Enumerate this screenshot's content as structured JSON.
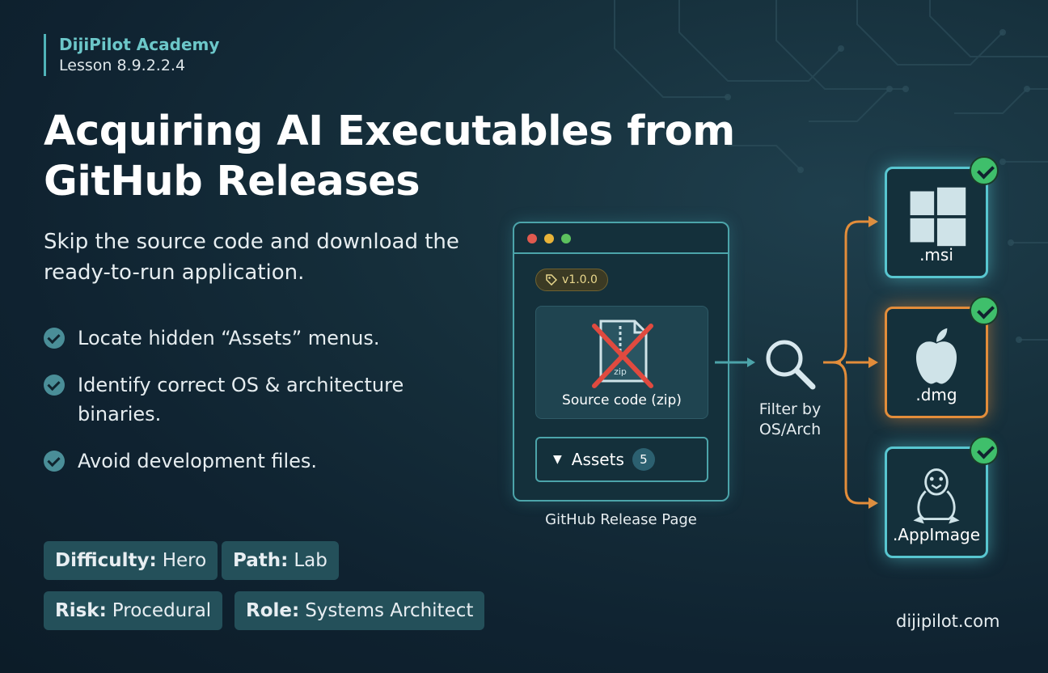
{
  "brand": {
    "name": "DijiPilot Academy",
    "lesson": "Lesson 8.9.2.2.4"
  },
  "title": "Acquiring AI Executables from GitHub Releases",
  "subtitle": "Skip the source code and download the ready-to-run application.",
  "bullets": [
    "Locate hidden “Assets” menus.",
    "Identify correct OS & architecture binaries.",
    "Avoid development files."
  ],
  "tags": {
    "difficulty": {
      "key": "Difficulty:",
      "value": "Hero"
    },
    "path": {
      "key": "Path:",
      "value": "Lab"
    },
    "risk": {
      "key": "Risk:",
      "value": "Procedural"
    },
    "role": {
      "key": "Role:",
      "value": "Systems Architect"
    }
  },
  "release_window": {
    "version_tag": "v1.0.0",
    "zip_glyph_text": "zip",
    "source_label": "Source code (zip)",
    "assets_label": "Assets",
    "assets_count": "5",
    "caption": "GitHub Release Page"
  },
  "filter": {
    "label_line1": "Filter by",
    "label_line2": "OS/Arch"
  },
  "outputs": [
    {
      "label": ".msi",
      "icon": "windows-icon",
      "status": "checked"
    },
    {
      "label": ".dmg",
      "icon": "apple-icon",
      "status": "checked"
    },
    {
      "label": ".AppImage",
      "icon": "linux-penguin-icon",
      "status": "checked"
    }
  ],
  "footer": {
    "site": "dijipilot.com"
  },
  "colors": {
    "background": "#132a36",
    "accent_teal": "#4fb3b8",
    "accent_orange": "#e38d3a",
    "check_green": "#3fbf6b",
    "window_dot_red": "#e05a4f",
    "window_dot_yellow": "#e8b339",
    "window_dot_green": "#5cc25e"
  }
}
